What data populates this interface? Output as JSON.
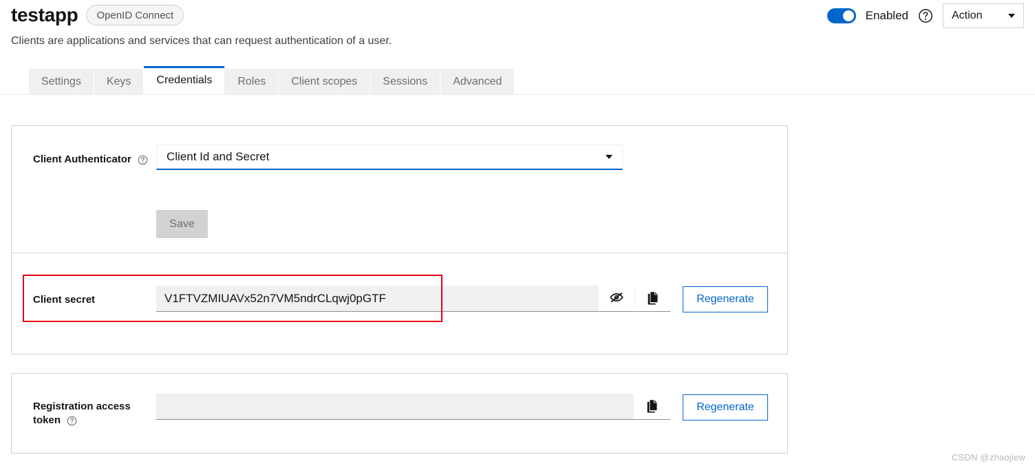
{
  "header": {
    "app_title": "testapp",
    "protocol_badge": "OpenID Connect",
    "subtitle": "Clients are applications and services that can request authentication of a user.",
    "toggle_enabled": true,
    "toggle_label": "Enabled",
    "help_icon": "help-circle-icon",
    "action_button": "Action",
    "caret_icon": "caret-down-icon",
    "accent_color": "#0066cc"
  },
  "tabs": [
    {
      "label": "Settings",
      "active": false
    },
    {
      "label": "Keys",
      "active": false
    },
    {
      "label": "Credentials",
      "active": true
    },
    {
      "label": "Roles",
      "active": false
    },
    {
      "label": "Client scopes",
      "active": false
    },
    {
      "label": "Sessions",
      "active": false
    },
    {
      "label": "Advanced",
      "active": false
    }
  ],
  "credentials_card": {
    "authenticator": {
      "label": "Client Authenticator",
      "help_icon": "help-circle-icon",
      "selected_value": "Client Id and Secret",
      "dropdown_icon": "caret-down-icon"
    },
    "save_button": {
      "label": "Save",
      "disabled": true
    },
    "client_secret": {
      "label": "Client secret",
      "value": "V1FTVZMIUAVx52n7VM5ndrCLqwj0pGTF",
      "hide_icon": "eye-slash-icon",
      "copy_icon": "copy-icon",
      "regenerate_button": "Regenerate"
    }
  },
  "registration_token_card": {
    "label_line1": "Registration access",
    "label_line2": "token",
    "help_icon": "help-circle-icon",
    "value": "",
    "copy_icon": "copy-icon",
    "regenerate_button": "Regenerate"
  },
  "annotation": {
    "color": "#e60012",
    "target": "client-secret-row"
  },
  "watermark": "CSDN @zhaojiew"
}
